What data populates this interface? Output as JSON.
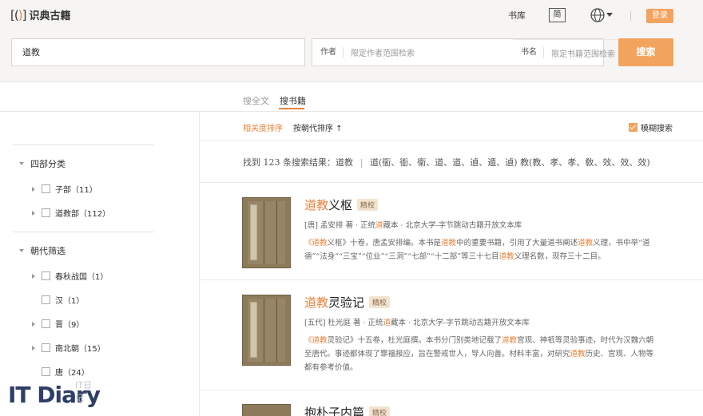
{
  "header": {
    "logo_mark": "[()]",
    "logo_text": "识典古籍",
    "library": "书库",
    "simplified": "简",
    "login": "登录"
  },
  "search": {
    "query": "道教",
    "book_label": "书名",
    "book_placeholder": "限定书籍范围检索",
    "author_label": "作者",
    "author_placeholder": "限定作者范围检索",
    "button": "搜索"
  },
  "tabs": [
    {
      "label": "搜全文",
      "active": false
    },
    {
      "label": "搜书籍",
      "active": true
    }
  ],
  "sidebar": {
    "categories": {
      "title": "四部分类",
      "items": [
        {
          "label": "子部（11）",
          "expandable": true
        },
        {
          "label": "道教部（112）",
          "expandable": true
        }
      ]
    },
    "dynasties": {
      "title": "朝代筛选",
      "items": [
        {
          "label": "春秋战国（1）",
          "expandable": true
        },
        {
          "label": "汉（1）",
          "expandable": false
        },
        {
          "label": "晋（9）",
          "expandable": true
        },
        {
          "label": "南北朝（15）",
          "expandable": true
        },
        {
          "label": "唐（24）",
          "expandable": false
        }
      ]
    }
  },
  "sort": {
    "relevance": "相关度排序",
    "dynasty": "按朝代排序 ↑",
    "fuzzy": "模糊搜索",
    "fuzzy_checked": true
  },
  "results": {
    "summary": "找到 123 条搜索结果：道教",
    "variants": "道(衟、衜、衞、道、道、遉、遁、遉) 教(教、孝、孝、敎、效、效、效)"
  },
  "books": [
    {
      "title_hl": "道教",
      "title_rest": "义枢",
      "badge": "精校",
      "meta_pre": "[唐] 孟安排 著 · 正统",
      "meta_hl": "道",
      "meta_post": "藏本 · 北京大学-字节跳动古籍开放文本库",
      "desc1_a": "《",
      "desc1_hl1": "道教",
      "desc1_b": "义枢》十卷，唐孟安排编。本书是",
      "desc1_hl2": "道教",
      "desc1_c": "中的重要书籍，引用了大量道书阐述",
      "desc1_hl3": "道教",
      "desc1_d": "义理，书中举“道",
      "desc2_a": "德”“法身”“三宝”“位业”“三洞”“七部”“十二部”等三十七目",
      "desc2_hl": "道教",
      "desc2_b": "义理名数，现存三十二目。",
      "cover_label": "义枢"
    },
    {
      "title_hl": "道教",
      "title_rest": "灵验记",
      "badge": "精校",
      "meta_pre": "[五代] 杜光庭 著 · 正统",
      "meta_hl": "道",
      "meta_post": "藏本 · 北京大学-字节跳动古籍开放文本库",
      "desc1_a": "《",
      "desc1_hl1": "道教",
      "desc1_b": "灵验记》十五卷，杜光庭撰。本书分门别类地记载了",
      "desc1_hl2": "道教",
      "desc1_c": "宫观、神祇等灵验事迹，时代为汉魏六朝",
      "desc2_a": "至唐代。事迹都体现了罪福报应，旨在警戒世人，导人向善。材料丰富，对研究",
      "desc2_hl": "道教",
      "desc2_b": "历史、宫观、人物等",
      "desc3": "都有参考价值。",
      "cover_label": "灵验"
    },
    {
      "title_rest": "抱朴子内篇",
      "badge": "精校"
    }
  ],
  "watermark": {
    "brand": "IT Diary",
    "sub": "IT日记"
  },
  "colors": {
    "accent": "#f2a35e",
    "highlight": "#e8823a"
  }
}
